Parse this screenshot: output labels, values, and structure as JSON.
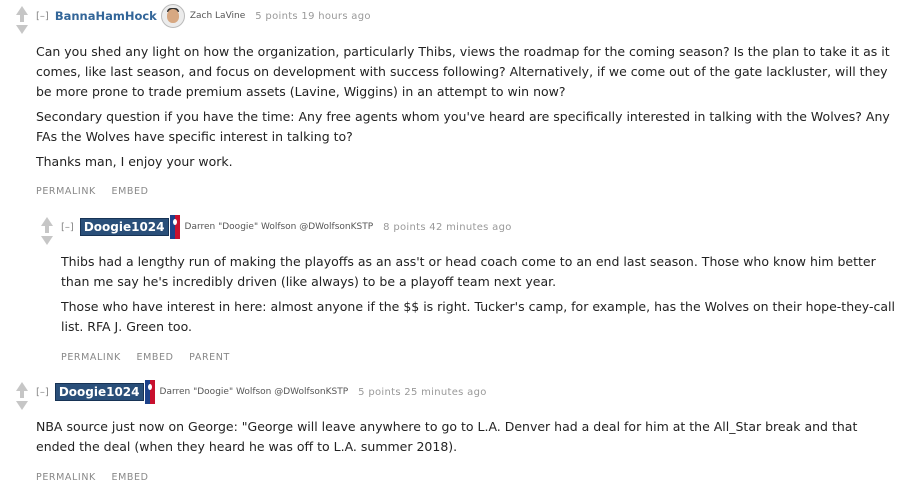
{
  "comments": [
    {
      "toggle": "[–]",
      "author": "BannaHamHock",
      "flair": "Zach LaVine",
      "score": "5 points 19 hours ago",
      "paragraphs": [
        "Can you shed any light on how the organization, particularly Thibs, views the roadmap for the coming season? Is the plan to take it as it comes, like last season, and focus on development with success following? Alternatively, if we come out of the gate lackluster, will they be more prone to trade premium assets (Lavine, Wiggins) in an attempt to win now?",
        "Secondary question if you have the time: Any free agents whom you've heard are specifically interested in talking with the Wolves? Any FAs the Wolves have specific interest in talking to?",
        "Thanks man, I enjoy your work."
      ],
      "buttons": [
        "PERMALINK",
        "EMBED"
      ]
    },
    {
      "toggle": "[–]",
      "author": "Doogie1024",
      "flair": "Darren \"Doogie\" Wolfson @DWolfsonKSTP",
      "score": "8 points 42 minutes ago",
      "paragraphs": [
        "Thibs had a lengthy run of making the playoffs as an ass't or head coach come to an end last season. Those who know him better than me say he's incredibly driven (like always) to be a playoff team next year.",
        "Those who have interest in here: almost anyone if the $$ is right. Tucker's camp, for example, has the Wolves on their hope-they-call list. RFA J. Green too."
      ],
      "buttons": [
        "PERMALINK",
        "EMBED",
        "PARENT"
      ]
    },
    {
      "toggle": "[–]",
      "author": "Doogie1024",
      "flair": "Darren \"Doogie\" Wolfson @DWolfsonKSTP",
      "score": "5 points 25 minutes ago",
      "paragraphs": [
        "NBA source just now on George: \"George will leave anywhere to go to L.A. Denver had a deal for him at the All_Star break and that ended the deal (when they heard he was off to L.A. summer 2018)."
      ],
      "buttons": [
        "PERMALINK",
        "EMBED"
      ]
    }
  ]
}
